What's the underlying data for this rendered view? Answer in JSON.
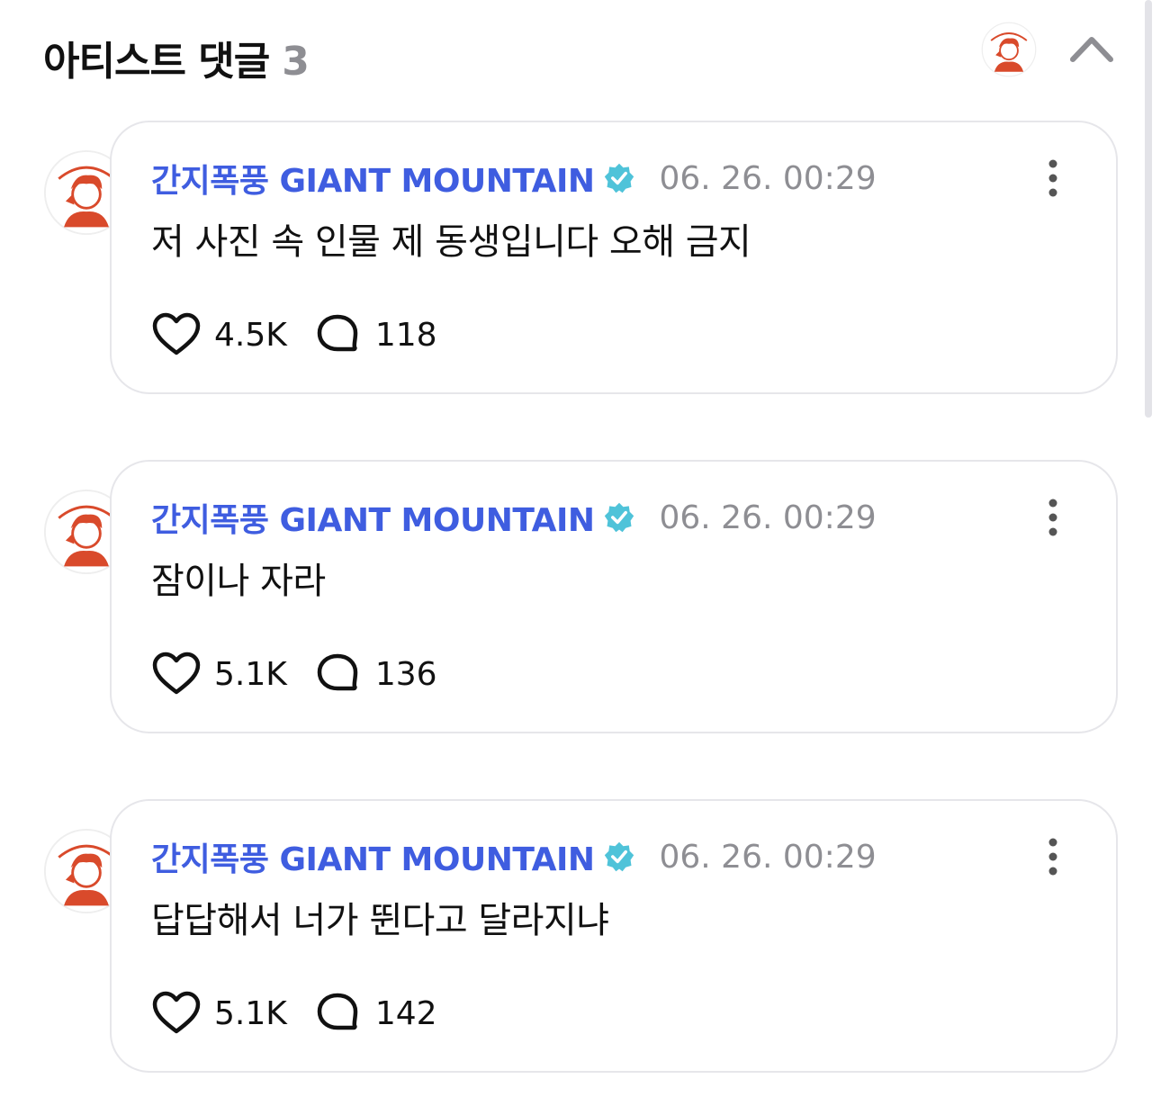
{
  "header": {
    "title": "아티스트 댓글",
    "count": "3"
  },
  "colors": {
    "author": "#3f5de0",
    "verified": "#4fc3d9",
    "timestamp": "#8e8e93",
    "card_border": "#e6e6ea",
    "avatar_red": "#d94a2b"
  },
  "comments": [
    {
      "author": "간지폭풍 GIANT MOUNTAIN",
      "time": "06. 26. 00:29",
      "text": "저 사진 속 인물 제 동생입니다 오해 금지",
      "likes": "4.5K",
      "replies": "118"
    },
    {
      "author": "간지폭풍 GIANT MOUNTAIN",
      "time": "06. 26. 00:29",
      "text": "잠이나 자라",
      "likes": "5.1K",
      "replies": "136"
    },
    {
      "author": "간지폭풍 GIANT MOUNTAIN",
      "time": "06. 26. 00:29",
      "text": "답답해서 너가 뛴다고 달라지냐",
      "likes": "5.1K",
      "replies": "142"
    }
  ]
}
